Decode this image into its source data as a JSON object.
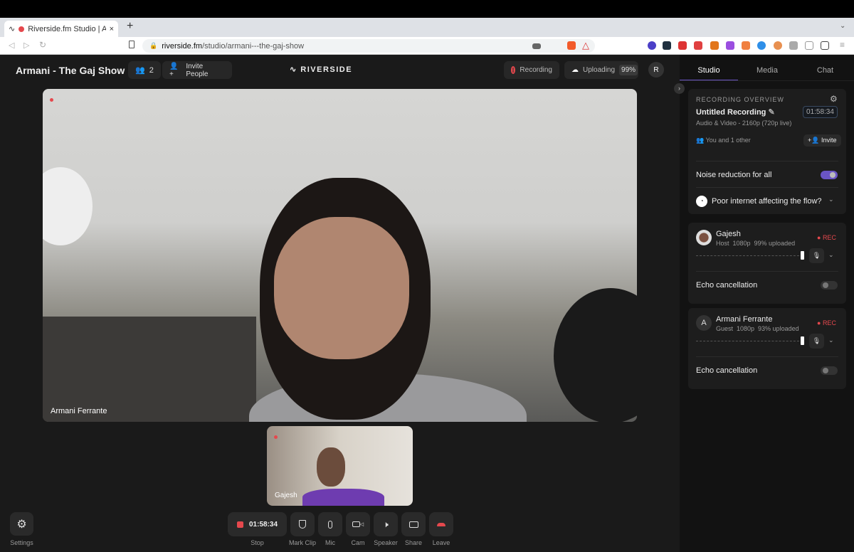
{
  "browser": {
    "tab_title": "Riverside.fm Studio | Armani",
    "url_domain": "riverside.fm",
    "url_path": "/studio/armani---the-gaj-show"
  },
  "header": {
    "show_title": "Armani - The Gaj Show",
    "participants_count": "2",
    "invite_label": "Invite People",
    "logo": "RIVERSIDE",
    "recording_label": "Recording",
    "uploading_label": "Uploading",
    "upload_percent": "99%",
    "avatar_initial": "R"
  },
  "video": {
    "main_name": "Armani Ferrante",
    "small_name": "Gajesh"
  },
  "controls": {
    "timer": "01:58:34",
    "stop": "Stop",
    "mark_clip": "Mark Clip",
    "mic": "Mic",
    "cam": "Cam",
    "speaker": "Speaker",
    "share": "Share",
    "leave": "Leave",
    "settings": "Settings"
  },
  "sidebar": {
    "tabs": [
      "Studio",
      "Media",
      "Chat"
    ],
    "overview": {
      "heading": "RECORDING OVERVIEW",
      "title": "Untitled Recording",
      "timer": "01:58:34",
      "quality": "Audio & Video - 2160p (720p live)",
      "people": "You and 1 other",
      "invite": "Invite",
      "noise": "Noise reduction for all",
      "noise_on": true,
      "poor_internet": "Poor internet affecting the flow?"
    },
    "participants": [
      {
        "name": "Gajesh",
        "details": "Host  1080p  99% uploaded",
        "rec": "REC",
        "echo": "Echo cancellation",
        "echo_on": false
      },
      {
        "name": "Armani Ferrante",
        "initial": "A",
        "details": "Guest  1080p  93% uploaded",
        "rec": "REC",
        "echo": "Echo cancellation",
        "echo_on": false
      }
    ]
  },
  "colors": {
    "accent": "#6a55c4",
    "rec": "#e5484d"
  }
}
